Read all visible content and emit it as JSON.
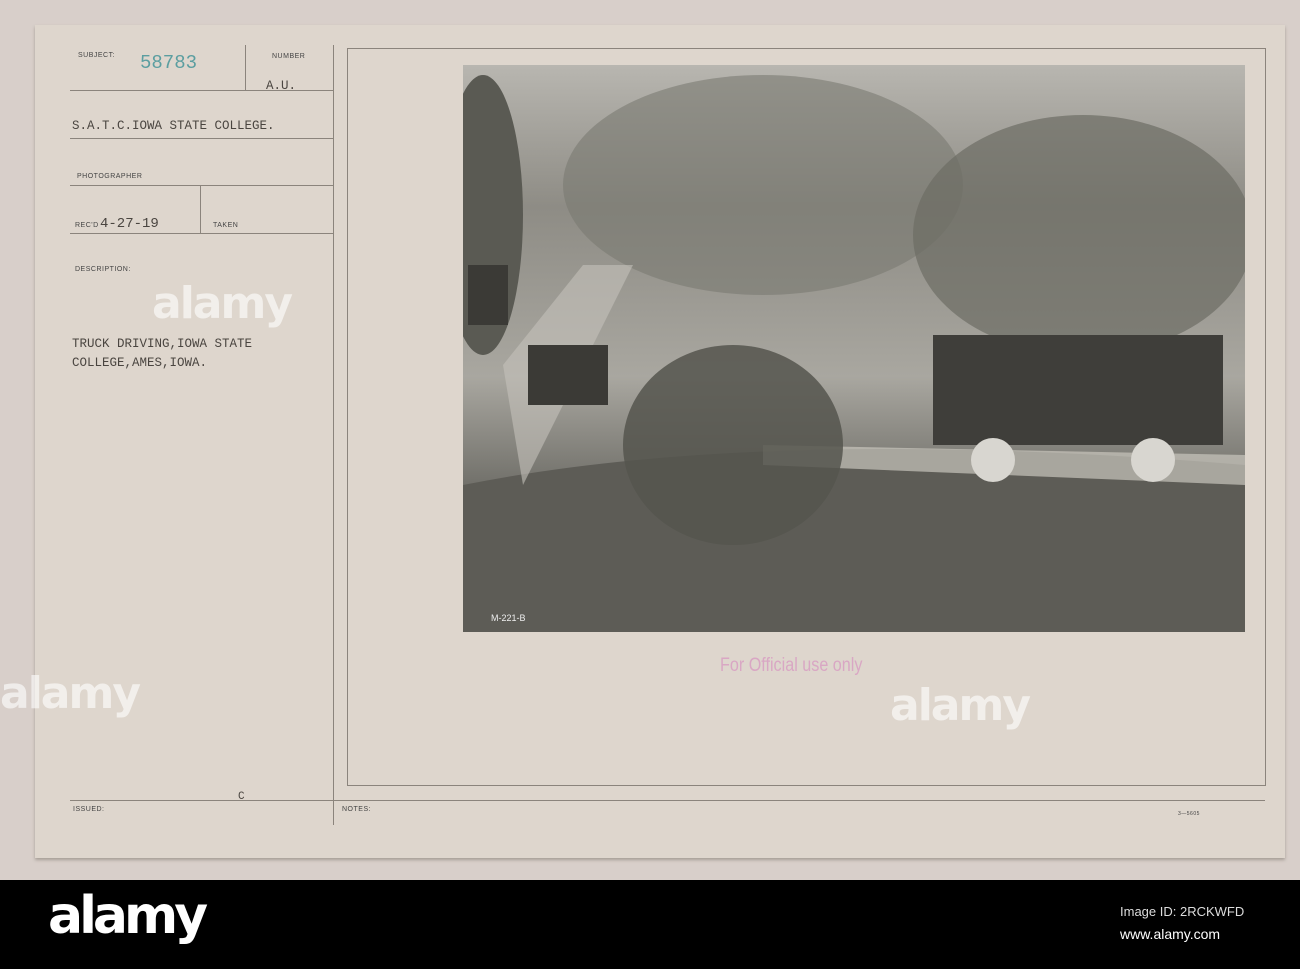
{
  "card": {
    "subject_label": "SUBJECT:",
    "subject_number": "58783",
    "number_label": "NUMBER",
    "number_value": "A.U.",
    "unit": "S.A.T.C.IOWA STATE COLLEGE.",
    "photographer_label": "PHOTOGRAPHER",
    "received_label": "REC'D",
    "received_date": "4-27-19",
    "taken_label": "TAKEN",
    "description_label": "DESCRIPTION:",
    "description_line1": "TRUCK DRIVING,IOWA STATE",
    "description_line2": "COLLEGE,AMES,IOWA.",
    "issued_label": "ISSUED:",
    "issued_mark": "C",
    "notes_label": "NOTES:",
    "form_number": "3—5605",
    "photo_caption": "M-221-B",
    "stamp": "For Official use only"
  },
  "watermark": {
    "text": "alamy",
    "image_id": "Image ID: 2RCKWFD",
    "url": "www.alamy.com"
  },
  "colors": {
    "card": "#ded6cd",
    "subject_number": "#5b9ea0",
    "stamp": "#d9a7c4",
    "footer": "#000000"
  }
}
